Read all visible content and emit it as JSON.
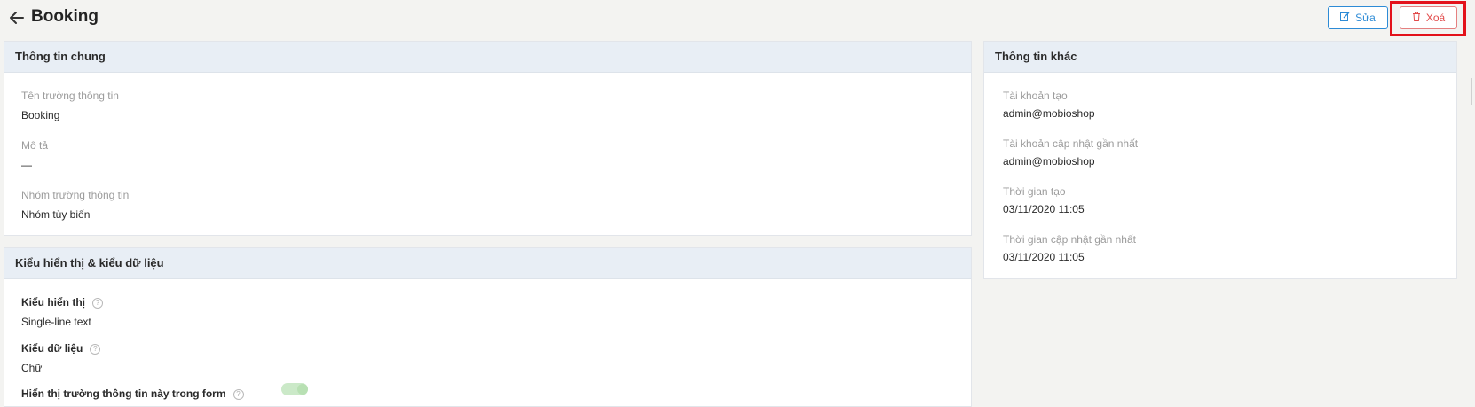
{
  "header": {
    "title": "Booking",
    "edit_label": "Sửa",
    "delete_label": "Xoá"
  },
  "general": {
    "title": "Thông tin chung",
    "fields": [
      {
        "label": "Tên trường thông tin",
        "value": "Booking"
      },
      {
        "label": "Mô tả",
        "value": "—"
      },
      {
        "label": "Nhóm trường thông tin",
        "value": "Nhóm tùy biến"
      }
    ]
  },
  "display": {
    "title": "Kiểu hiển thị & kiểu dữ liệu",
    "display_type_label": "Kiểu hiển thị",
    "display_type_value": "Single-line text",
    "data_type_label": "Kiểu dữ liệu",
    "data_type_value": "Chữ",
    "show_in_form_label": "Hiển thị trường thông tin này trong form",
    "show_in_form": true
  },
  "other": {
    "title": "Thông tin khác",
    "fields": [
      {
        "label": "Tài khoản tạo",
        "value": "admin@mobioshop"
      },
      {
        "label": "Tài khoản cập nhật gần nhất",
        "value": "admin@mobioshop"
      },
      {
        "label": "Thời gian tạo",
        "value": "03/11/2020 11:05"
      },
      {
        "label": "Thời gian cập nhật gần nhất",
        "value": "03/11/2020 11:05"
      }
    ]
  },
  "icons": {
    "back": "arrow-left-icon",
    "edit": "edit-icon",
    "delete": "trash-icon",
    "help": "question-circle-icon"
  },
  "colors": {
    "accent": "#2d8bd6",
    "danger": "#e24b4b",
    "highlight": "#e3121b",
    "header_bg": "#e8eef5"
  }
}
